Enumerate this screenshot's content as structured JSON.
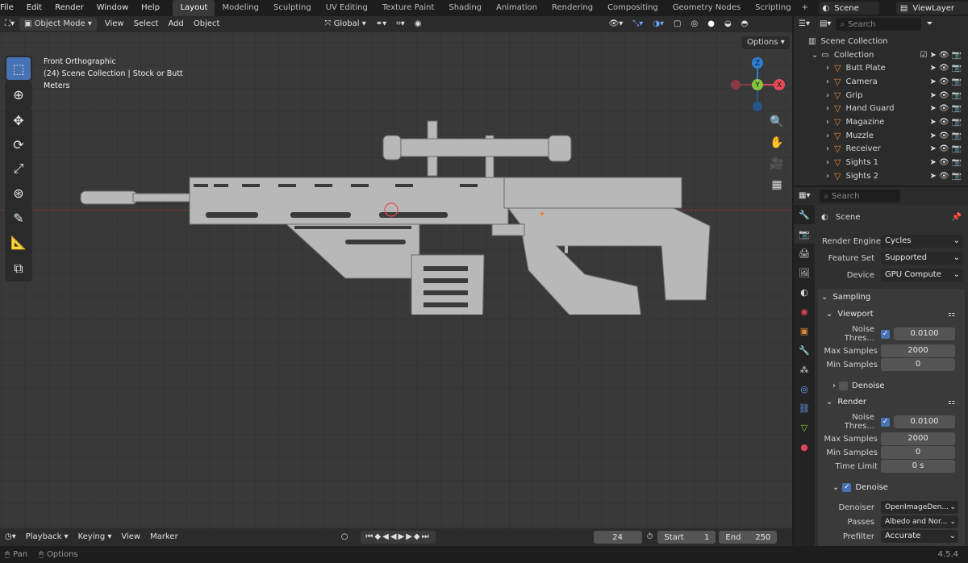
{
  "menus": [
    "File",
    "Edit",
    "Render",
    "Window",
    "Help"
  ],
  "workspaces": [
    "Layout",
    "Modeling",
    "Sculpting",
    "UV Editing",
    "Texture Paint",
    "Shading",
    "Animation",
    "Rendering",
    "Compositing",
    "Geometry Nodes",
    "Scripting"
  ],
  "workspace_add": "+",
  "scene_selector": {
    "value": "Scene"
  },
  "viewlayer_selector": {
    "value": "ViewLayer"
  },
  "viewport_header": {
    "mode": "Object Mode",
    "menus": [
      "View",
      "Select",
      "Add",
      "Object"
    ],
    "transform_orientation": "Global",
    "options_label": "Options"
  },
  "viewport_overlay": {
    "view_name": "Front Orthographic",
    "collection_info": "(24) Scene Collection | Stock or Butt",
    "units": "Meters"
  },
  "gizmo": {
    "z": "Z",
    "y": "Y",
    "x": "X"
  },
  "colors": {
    "accent": "#4772b3",
    "object_orange": "#e3873b",
    "axis_x": "#e94a5a",
    "axis_y": "#86c540",
    "axis_z": "#2e7fd6"
  },
  "outliner": {
    "search_placeholder": "Search",
    "root": "Scene Collection",
    "collection": "Collection",
    "items": [
      {
        "name": "Butt Plate"
      },
      {
        "name": "Camera"
      },
      {
        "name": "Grip"
      },
      {
        "name": "Hand Guard"
      },
      {
        "name": "Magazine"
      },
      {
        "name": "Muzzle"
      },
      {
        "name": "Receiver"
      },
      {
        "name": "Sights 1"
      },
      {
        "name": "Sights 2"
      }
    ]
  },
  "properties": {
    "search_placeholder": "Search",
    "context": "Scene",
    "render_engine": {
      "label": "Render Engine",
      "value": "Cycles"
    },
    "feature_set": {
      "label": "Feature Set",
      "value": "Supported"
    },
    "device": {
      "label": "Device",
      "value": "GPU Compute"
    },
    "sampling": {
      "title": "Sampling",
      "viewport": {
        "title": "Viewport",
        "noise_threshold": {
          "label": "Noise Thres...",
          "value": "0.0100"
        },
        "max_samples": {
          "label": "Max Samples",
          "value": "2000"
        },
        "min_samples": {
          "label": "Min Samples",
          "value": "0"
        },
        "denoise_label": "Denoise"
      },
      "render": {
        "title": "Render",
        "noise_threshold": {
          "label": "Noise Thres...",
          "value": "0.0100"
        },
        "max_samples": {
          "label": "Max Samples",
          "value": "2000"
        },
        "min_samples": {
          "label": "Min Samples",
          "value": "0"
        },
        "time_limit": {
          "label": "Time Limit",
          "value": "0 s"
        },
        "denoise": {
          "label": "Denoise",
          "denoiser": {
            "label": "Denoiser",
            "value": "OpenImageDen..."
          },
          "passes": {
            "label": "Passes",
            "value": "Albedo and Nor..."
          },
          "prefilter": {
            "label": "Prefilter",
            "value": "Accurate"
          }
        }
      }
    }
  },
  "timeline": {
    "menus": [
      "Playback",
      "Keying",
      "View",
      "Marker"
    ],
    "current_frame": "24",
    "start_label": "Start",
    "start_value": "1",
    "end_label": "End",
    "end_value": "250"
  },
  "statusbar": {
    "pan_label": "Pan",
    "options_label": "Options",
    "version": "4.5.4"
  }
}
